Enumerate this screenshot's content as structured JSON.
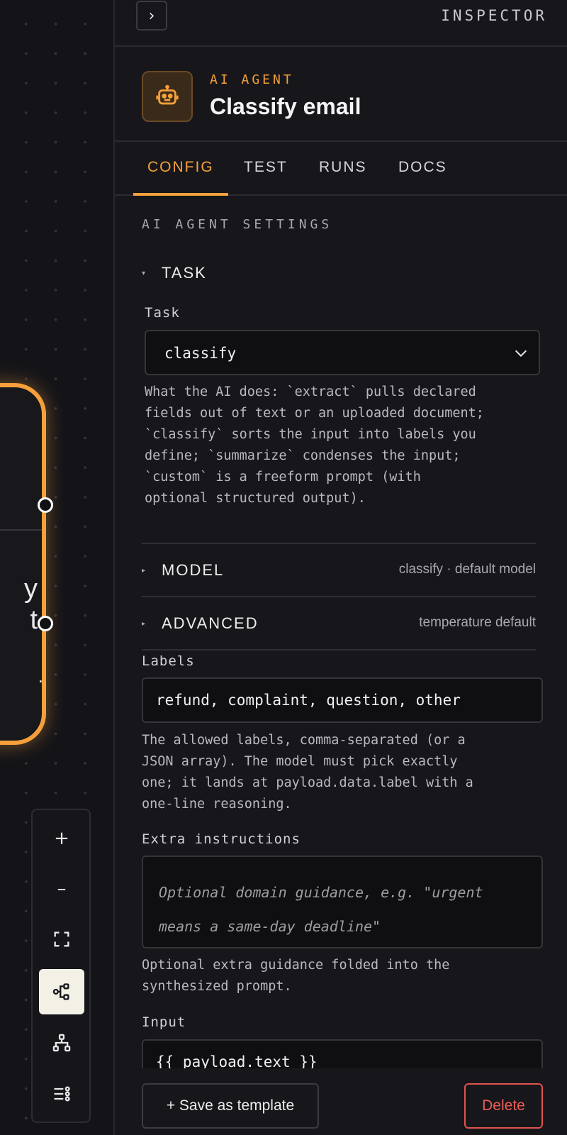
{
  "canvas": {
    "node": {
      "lines": [
        "y",
        "t"
      ],
      "trailing": "."
    },
    "tools": {
      "zoom_in": "+",
      "zoom_out": "–",
      "fit_view_icon": "fit-view-icon",
      "branch_icon": "branch-icon",
      "tree_icon": "tree-layout-icon",
      "list_icon": "list-settings-icon"
    },
    "accent": "#f5a03b"
  },
  "inspector": {
    "collapse_label": "›",
    "title": "INSPECTOR",
    "node_kind": "AI AGENT",
    "node_name": "Classify email",
    "tabs": [
      "CONFIG",
      "TEST",
      "RUNS",
      "DOCS"
    ],
    "active_tab": "CONFIG",
    "section_heading": "AI AGENT SETTINGS",
    "task": {
      "caret": "▾",
      "toggle": "TASK",
      "label": "Task",
      "value": "classify",
      "help": "What the AI does: `extract` pulls declared\nfields out of text or an uploaded document;\n`classify` sorts the input into labels you\ndefine; `summarize` condenses the input;\n`custom` is a freeform prompt (with\noptional structured output)."
    },
    "model": {
      "caret": "▸",
      "toggle": "MODEL",
      "summary": "classify · default model"
    },
    "advanced": {
      "caret": "▸",
      "toggle": "ADVANCED",
      "summary": "temperature default"
    },
    "labels": {
      "label": "Labels",
      "value": "refund, complaint, question, other",
      "help": "The allowed labels, comma-separated (or a\nJSON array). The model must pick exactly\none; it lands at payload.data.label with a\none-line reasoning."
    },
    "extra": {
      "label": "Extra instructions",
      "placeholder": "Optional domain guidance, e.g. \"urgent means a same-day deadline\"",
      "help": "Optional extra guidance folded into the\nsynthesized prompt."
    },
    "input": {
      "label": "Input",
      "value": "{{ payload.text }}"
    },
    "footer": {
      "save_template": "+ Save as template",
      "delete": "Delete"
    }
  }
}
